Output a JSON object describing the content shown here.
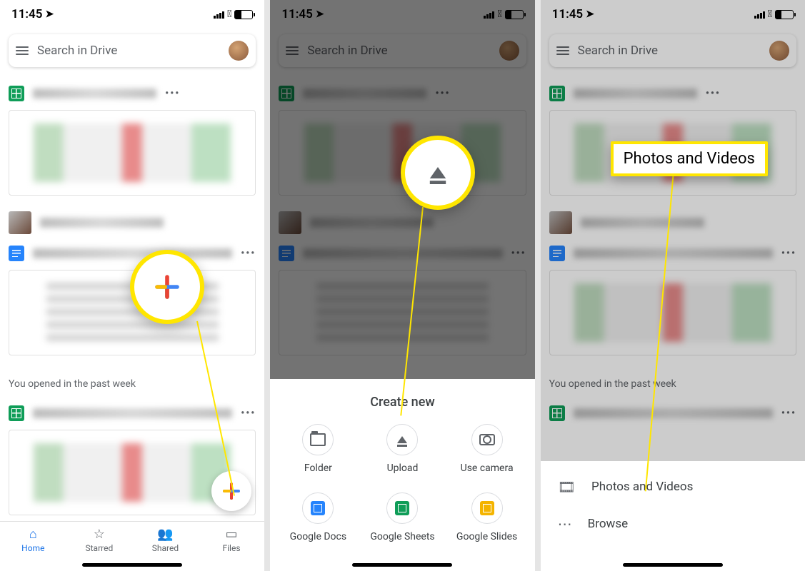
{
  "status": {
    "time": "11:45"
  },
  "search": {
    "placeholder": "Search in Drive"
  },
  "section_label": "You opened in the past week",
  "nav": {
    "home": "Home",
    "starred": "Starred",
    "shared": "Shared",
    "files": "Files"
  },
  "create_sheet": {
    "title": "Create new",
    "items": {
      "folder": "Folder",
      "upload": "Upload",
      "camera": "Use camera",
      "docs": "Google Docs",
      "sheets": "Google Sheets",
      "slides": "Google Slides"
    }
  },
  "upload_menu": {
    "photos_videos": "Photos and Videos",
    "browse": "Browse"
  },
  "callout": {
    "photos_videos": "Photos and Videos"
  }
}
